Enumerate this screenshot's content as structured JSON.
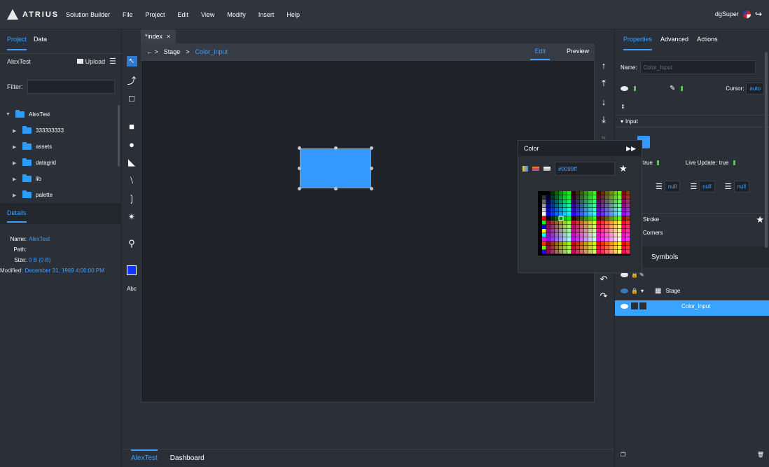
{
  "app": {
    "brand": "ATRIUS",
    "product": "Solution Builder"
  },
  "menu": [
    "File",
    "Project",
    "Edit",
    "View",
    "Modify",
    "Insert",
    "Help"
  ],
  "user": {
    "name": "dgSuper"
  },
  "left": {
    "tabs": [
      "Project",
      "Data"
    ],
    "project_name": "AlexTest",
    "upload_label": "Upload",
    "filter_label": "Filter:",
    "tree": [
      {
        "label": "AlexTest",
        "level": 0
      },
      {
        "label": "333333333",
        "level": 1
      },
      {
        "label": "assets",
        "level": 1
      },
      {
        "label": "datagrid",
        "level": 1
      },
      {
        "label": "lib",
        "level": 1
      },
      {
        "label": "palette",
        "level": 1
      }
    ],
    "details_title": "Details",
    "details": {
      "name_k": "Name:",
      "name_v": "AlexTest",
      "path_k": "Path:",
      "path_v": "",
      "size_k": "Size:",
      "size_v": "0 B (0 B)",
      "mod_k": "Modified:",
      "mod_v": "December 31, 1969 4:00:00 PM"
    }
  },
  "tools": {
    "text_tool": "Abc"
  },
  "editor": {
    "tab_label": "*index",
    "crumbs": [
      "Stage",
      "Color_Input"
    ],
    "edit_label": "Edit",
    "preview_label": "Preview"
  },
  "color_popup": {
    "title": "Color",
    "hex": "#0099ff"
  },
  "right": {
    "tabs": [
      "Properties",
      "Advanced",
      "Actions"
    ],
    "name_label": "Name:",
    "name_placeholder": "Color_Input",
    "cursor_label": "Cursor:",
    "cursor_value": "auto",
    "section_input": "Input",
    "true_label": "true",
    "live_update_label": "Live Update:",
    "live_update_value": "true",
    "null_value": "null",
    "stroke_label": "Stroke",
    "corners_label": "Corners",
    "symbols_label": "Symbols",
    "layer_stage": "Stage",
    "layer_color_input": "Color_Input"
  },
  "bottom": {
    "tabs": [
      "AlexTest",
      "Dashboard"
    ]
  },
  "colors": {
    "accent": "#3fa0ff",
    "shape_fill": "#3399ff"
  }
}
